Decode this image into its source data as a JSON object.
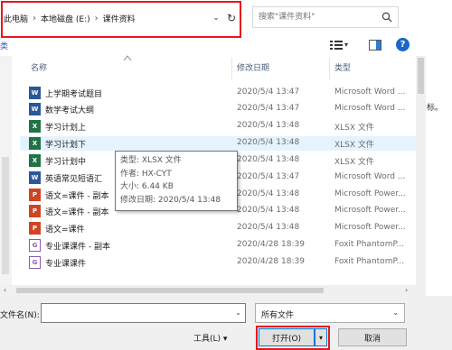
{
  "address": {
    "crumbs": [
      "此电脑",
      "本地磁盘 (E:)",
      "课件资料"
    ],
    "dropdown_icon": "chevron-down-icon",
    "refresh_icon": "refresh-icon"
  },
  "search": {
    "placeholder": "搜索\"课件资料\""
  },
  "toolbar": {
    "left_fragment": "类"
  },
  "columns": {
    "name": "名称",
    "date": "修改日期",
    "type": "类型"
  },
  "files": [
    {
      "name": "上学期考试题目",
      "date": "2020/5/4 13:47",
      "type": "Microsoft Word ...",
      "icon": "word-doc-icon",
      "kind": "word"
    },
    {
      "name": "数学考试大纲",
      "date": "2020/5/4 13:47",
      "type": "Microsoft Word ...",
      "icon": "word-doc-icon",
      "kind": "word"
    },
    {
      "name": "学习计划上",
      "date": "2020/5/4 13:48",
      "type": "XLSX 文件",
      "icon": "excel-icon",
      "kind": "xlsx"
    },
    {
      "name": "学习计划下",
      "date": "2020/5/4 13:48",
      "type": "XLSX 文件",
      "icon": "excel-icon",
      "kind": "xlsx",
      "selected": true
    },
    {
      "name": "学习计划中",
      "date": "2020/5/4 13:48",
      "type": "XLSX 文件",
      "icon": "excel-icon",
      "kind": "xlsx"
    },
    {
      "name": "英语常见短语汇",
      "date": "2020/5/4 13:47",
      "type": "Microsoft Word ...",
      "icon": "word-doc-icon",
      "kind": "word"
    },
    {
      "name": "语文=课件 - 副本",
      "date": "2020/5/4 13:48",
      "type": "Microsoft Power...",
      "icon": "powerpoint-icon",
      "kind": "ppt"
    },
    {
      "name": "语文=课件 - 副本",
      "date": "2020/5/4 13:48",
      "type": "Microsoft Power...",
      "icon": "powerpoint-icon",
      "kind": "ppt"
    },
    {
      "name": "语文=课件",
      "date": "2020/5/4 13:48",
      "type": "Microsoft Power...",
      "icon": "powerpoint-icon",
      "kind": "ppt"
    },
    {
      "name": "专业课课件 - 副本",
      "date": "2020/4/28 18:39",
      "type": "Foxit PhantomP...",
      "icon": "foxit-pdf-icon",
      "kind": "foxit"
    },
    {
      "name": "专业课课件",
      "date": "2020/4/28 18:39",
      "type": "Foxit PhantomP...",
      "icon": "foxit-pdf-icon",
      "kind": "foxit"
    }
  ],
  "tooltip": {
    "type": "类型: XLSX 文件",
    "author": "作者: HX-CYT",
    "size": "大小: 6.44 KB",
    "modified": "修改日期: 2020/5/4 13:48"
  },
  "outside_text": "标。",
  "bottom": {
    "filename_label": "文件名(N):",
    "filename_value": "",
    "filetype_value": "所有文件",
    "tools_label": "工具(L)",
    "open_label": "打开(O)",
    "cancel_label": "取消"
  },
  "colors": {
    "accent": "#0078d7",
    "highlight_box": "#e8171c",
    "selected_row": "#e5f3ff"
  }
}
